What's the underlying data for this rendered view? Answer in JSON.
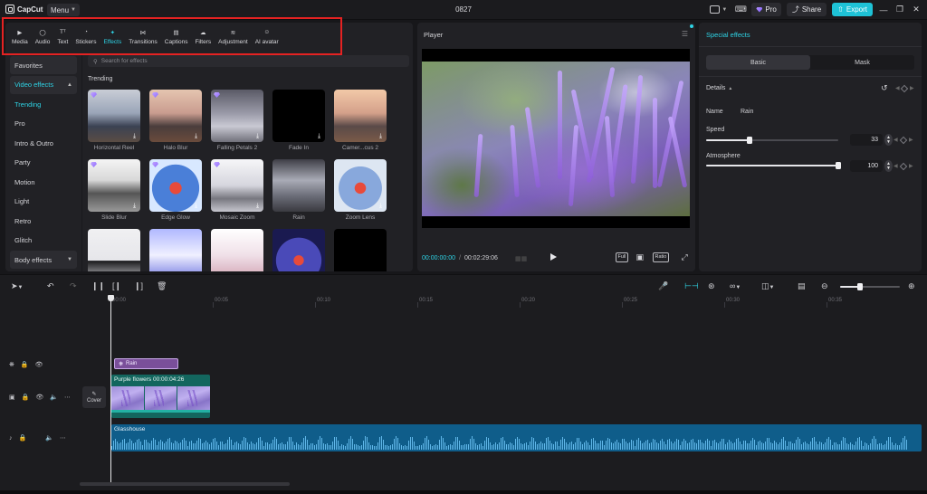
{
  "titlebar": {
    "app_name": "CapCut",
    "menu_label": "Menu",
    "project_title": "0827",
    "pro_label": "Pro",
    "share_label": "Share",
    "export_label": "Export"
  },
  "toolbar": {
    "items": [
      {
        "label": "Media",
        "icon": "media-icon"
      },
      {
        "label": "Audio",
        "icon": "audio-icon"
      },
      {
        "label": "Text",
        "icon": "text-icon"
      },
      {
        "label": "Stickers",
        "icon": "stickers-icon"
      },
      {
        "label": "Effects",
        "icon": "effects-icon",
        "active": true
      },
      {
        "label": "Transitions",
        "icon": "transitions-icon"
      },
      {
        "label": "Captions",
        "icon": "captions-icon"
      },
      {
        "label": "Filters",
        "icon": "filters-icon"
      },
      {
        "label": "Adjustment",
        "icon": "adjustment-icon"
      },
      {
        "label": "AI avatar",
        "icon": "ai-avatar-icon"
      }
    ],
    "accent_color": "#2ed4e6",
    "highlight_color": "#e52222"
  },
  "categories": {
    "favorites": "Favorites",
    "video_effects": "Video effects",
    "items": [
      "Trending",
      "Pro",
      "Intro & Outro",
      "Party",
      "Motion",
      "Light",
      "Retro",
      "Glitch"
    ],
    "body_effects": "Body effects"
  },
  "effects": {
    "search_placeholder": "Search for effects",
    "section_title": "Trending",
    "cards": [
      {
        "label": "Horizontal Reel",
        "premium": true,
        "download": true
      },
      {
        "label": "Halo Blur",
        "premium": true,
        "download": true
      },
      {
        "label": "Falling Petals 2",
        "premium": true,
        "download": true
      },
      {
        "label": "Fade In",
        "premium": false,
        "download": true
      },
      {
        "label": "Camer...cus 2",
        "premium": false,
        "download": true
      },
      {
        "label": "Slide Blur",
        "premium": true,
        "download": true
      },
      {
        "label": "Edge Glow",
        "premium": true,
        "download": true
      },
      {
        "label": "Mosaic Zoom",
        "premium": true,
        "download": true
      },
      {
        "label": "Rain",
        "premium": false,
        "download": false
      },
      {
        "label": "Zoom Lens",
        "premium": false,
        "download": true
      },
      {
        "label": "",
        "premium": false,
        "download": false
      },
      {
        "label": "",
        "premium": false,
        "download": false
      },
      {
        "label": "",
        "premium": false,
        "download": false
      },
      {
        "label": "",
        "premium": false,
        "download": false
      },
      {
        "label": "",
        "premium": false,
        "download": false
      }
    ]
  },
  "player": {
    "title": "Player",
    "current_time": "00:00:00:00",
    "total_time": "00:02:29:06",
    "full_label": "Full",
    "ratio_label": "Ratio"
  },
  "special_effects": {
    "title": "Special effects",
    "tabs": [
      "Basic",
      "Mask"
    ],
    "details_label": "Details",
    "name_label": "Name",
    "name_value": "Rain",
    "speed_label": "Speed",
    "speed_value": "33",
    "speed_fraction": 0.33,
    "atmosphere_label": "Atmosphere",
    "atmosphere_value": "100",
    "atmosphere_fraction": 1.0
  },
  "timeline": {
    "ruler_labels": [
      "00:00",
      "00:05",
      "00:10",
      "00:15",
      "00:20",
      "00:25",
      "00:30",
      "00:35"
    ],
    "effect_clip_label": "Rain",
    "video_clip_label": "Purple flowers",
    "video_clip_duration": "00:00:04:26",
    "cover_label": "Cover",
    "audio_clip_label": "Glasshouse"
  }
}
